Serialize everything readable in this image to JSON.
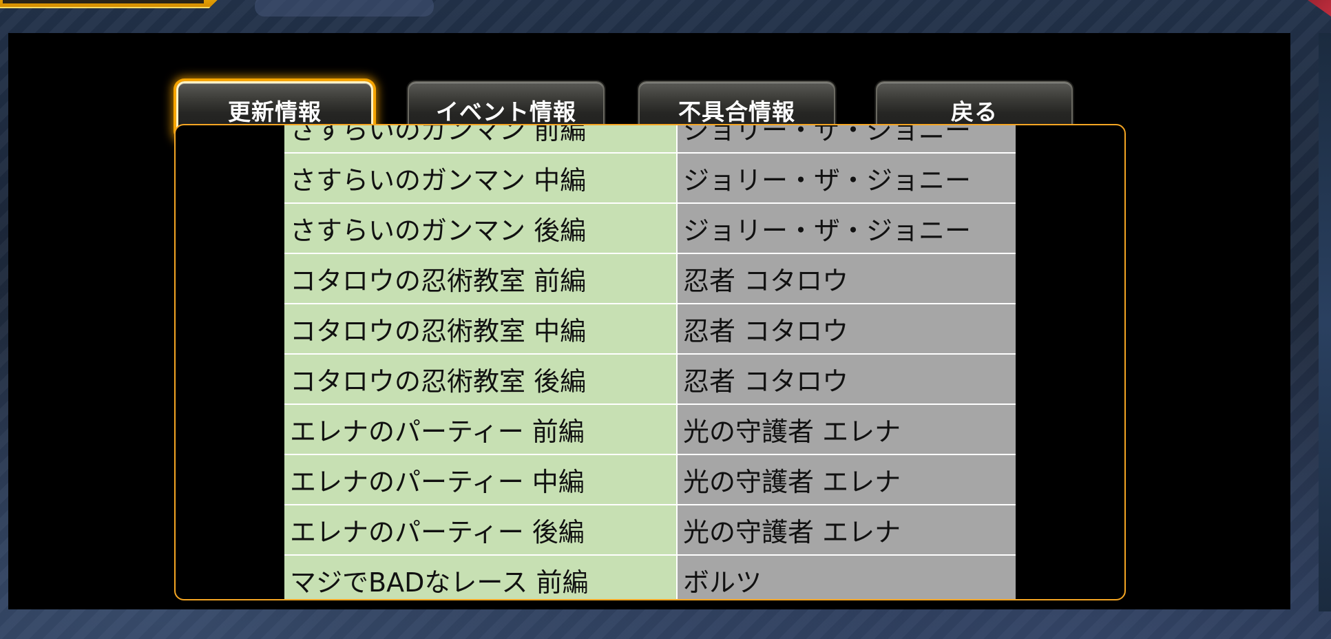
{
  "nav": {
    "buttons": [
      {
        "label": "更新情報",
        "active": true
      },
      {
        "label": "イベント情報",
        "active": false
      },
      {
        "label": "不具合情報",
        "active": false
      },
      {
        "label": "戻る",
        "active": false
      }
    ]
  },
  "table": {
    "rows": [
      {
        "event": "さすらいのガンマン 前編",
        "character": "ジョリー・ザ・ジョニー"
      },
      {
        "event": "さすらいのガンマン 中編",
        "character": "ジョリー・ザ・ジョニー"
      },
      {
        "event": "さすらいのガンマン 後編",
        "character": "ジョリー・ザ・ジョニー"
      },
      {
        "event": "コタロウの忍術教室 前編",
        "character": "忍者 コタロウ"
      },
      {
        "event": "コタロウの忍術教室 中編",
        "character": "忍者 コタロウ"
      },
      {
        "event": "コタロウの忍術教室 後編",
        "character": "忍者 コタロウ"
      },
      {
        "event": "エレナのパーティー 前編",
        "character": "光の守護者 エレナ"
      },
      {
        "event": "エレナのパーティー 中編",
        "character": "光の守護者 エレナ"
      },
      {
        "event": "エレナのパーティー 後編",
        "character": "光の守護者 エレナ"
      },
      {
        "event": "マジでBADなレース 前編",
        "character": "ボルツ"
      },
      {
        "event": "",
        "character": ""
      }
    ]
  },
  "colors": {
    "accent": "#f5a623",
    "event_cell": "#c7e0b3",
    "character_cell": "#a6a6a6",
    "panel": "#000000"
  }
}
